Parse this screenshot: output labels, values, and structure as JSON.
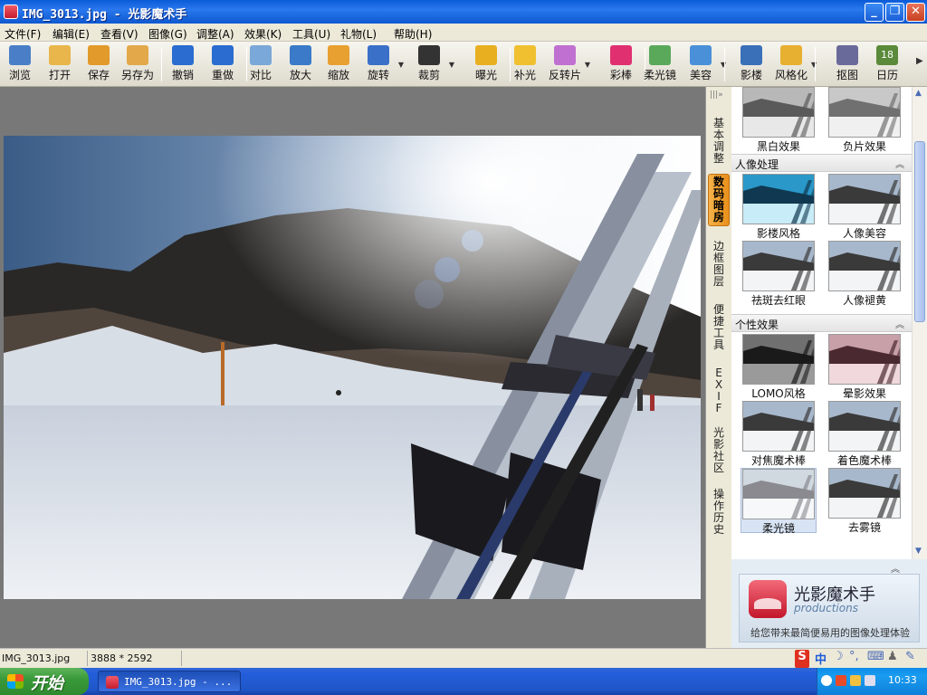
{
  "window": {
    "title": "IMG_3013.jpg - 光影魔术手",
    "minimize_label": "_",
    "restore_label": "❐",
    "close_label": "✕"
  },
  "menu": [
    {
      "label": "文件(F)"
    },
    {
      "label": "编辑(E)"
    },
    {
      "label": "查看(V)"
    },
    {
      "label": "图像(G)"
    },
    {
      "label": "调整(A)"
    },
    {
      "label": "效果(K)"
    },
    {
      "label": "工具(U)"
    },
    {
      "label": "礼物(L)"
    },
    {
      "label": "帮助(H)"
    }
  ],
  "toolbar": [
    {
      "label": "浏览",
      "icon": "browse-icon",
      "color": "#4a7fc8"
    },
    {
      "label": "打开",
      "icon": "folder-open-icon",
      "color": "#e8b64a"
    },
    {
      "label": "保存",
      "icon": "save-icon",
      "color": "#e29a2a"
    },
    {
      "label": "另存为",
      "icon": "save-as-icon",
      "color": "#e2a84a"
    },
    {
      "label": "撤销",
      "icon": "undo-icon",
      "color": "#2a6cd0"
    },
    {
      "label": "重做",
      "icon": "redo-icon",
      "color": "#2a6cd0"
    },
    {
      "label": "对比",
      "icon": "compare-icon",
      "color": "#7aa8d8"
    },
    {
      "label": "放大",
      "icon": "zoom-in-icon",
      "color": "#3a7ac8"
    },
    {
      "label": "缩放",
      "icon": "resize-icon",
      "color": "#e8a030"
    },
    {
      "label": "旋转",
      "icon": "rotate-icon",
      "color": "#3a70c8"
    },
    {
      "label": "裁剪",
      "icon": "crop-icon",
      "color": "#333333"
    },
    {
      "label": "曝光",
      "icon": "exposure-icon",
      "color": "#e8b020"
    },
    {
      "label": "补光",
      "icon": "fill-light-icon",
      "color": "#f0c030"
    },
    {
      "label": "反转片",
      "icon": "reversal-film-icon",
      "color": "#c070d0"
    },
    {
      "label": "彩棒",
      "icon": "color-wand-icon",
      "color": "#e03070"
    },
    {
      "label": "柔光镜",
      "icon": "soft-focus-icon",
      "color": "#5aa85a"
    },
    {
      "label": "美容",
      "icon": "beauty-face-icon",
      "color": "#4a90d8"
    },
    {
      "label": "影楼",
      "icon": "studio-icon",
      "color": "#3a70b8"
    },
    {
      "label": "风格化",
      "icon": "stylize-icon",
      "color": "#e8b030"
    },
    {
      "label": "抠图",
      "icon": "cutout-icon",
      "color": "#6a6a9a"
    },
    {
      "label": "日历",
      "icon": "calendar-icon",
      "color": "#5a8a3a",
      "badge": "18"
    }
  ],
  "side_tabs": [
    {
      "label": "基本调整",
      "active": false
    },
    {
      "label": "数码暗房",
      "active": true
    },
    {
      "label": "边框图层",
      "active": false
    },
    {
      "label": "便捷工具",
      "active": false
    },
    {
      "label": "EXIF",
      "active": false
    },
    {
      "label": "光影社区",
      "active": false
    },
    {
      "label": "操作历史",
      "active": false
    }
  ],
  "effects_panel": {
    "top_items": [
      {
        "label": "黑白效果",
        "tone": "bw"
      },
      {
        "label": "负片效果",
        "tone": "neg"
      }
    ],
    "sections": [
      {
        "title": "人像处理",
        "items": [
          {
            "label": "影楼风格",
            "tone": "cyan"
          },
          {
            "label": "人像美容",
            "tone": "normal"
          },
          {
            "label": "祛斑去红眼",
            "tone": "normal"
          },
          {
            "label": "人像褪黄",
            "tone": "normal"
          }
        ]
      },
      {
        "title": "个性效果",
        "items": [
          {
            "label": "LOMO风格",
            "tone": "dark"
          },
          {
            "label": "晕影效果",
            "tone": "red"
          },
          {
            "label": "对焦魔术棒",
            "tone": "normal"
          },
          {
            "label": "着色魔术棒",
            "tone": "normal"
          },
          {
            "label": "柔光镜",
            "tone": "soft",
            "selected": true
          },
          {
            "label": "去雾镜",
            "tone": "normal"
          },
          {
            "label": "",
            "tone": "green"
          },
          {
            "label": "",
            "tone": "blue"
          }
        ]
      }
    ],
    "collapse_glyph": "︽"
  },
  "banner": {
    "name": "光影魔术手",
    "sub": "productions",
    "slogan": "给您带来最简便易用的图像处理体验"
  },
  "status": {
    "filename": "IMG_3013.jpg",
    "dimensions": "3888 * 2592"
  },
  "ime": {
    "lang": "中"
  },
  "taskbar": {
    "start_label": "开始",
    "task_label": "IMG_3013.jpg - ...",
    "clock": "10:33"
  }
}
